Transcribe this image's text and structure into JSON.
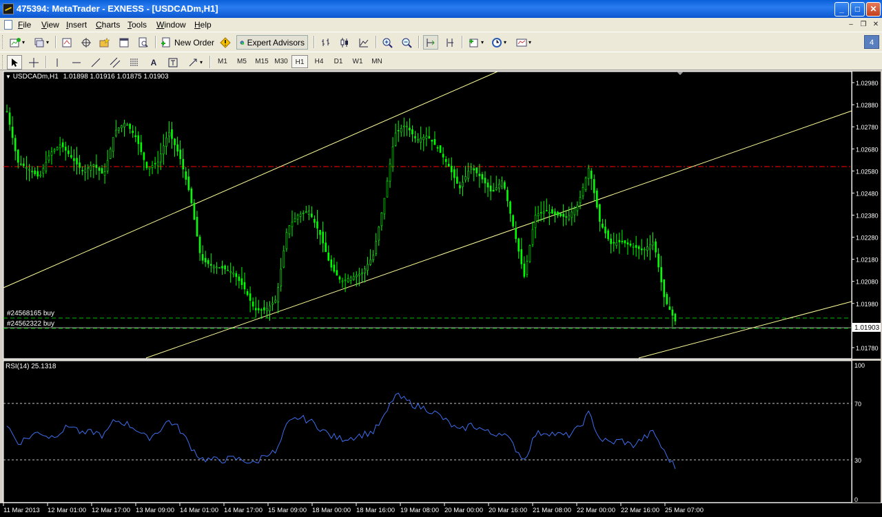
{
  "window": {
    "title": "475394: MetaTrader - EXNESS - [USDCADm,H1]",
    "buttons": {
      "minimize": "_",
      "maximize": "□",
      "close": "✕"
    }
  },
  "menu": {
    "items": [
      "File",
      "View",
      "Insert",
      "Charts",
      "Tools",
      "Window",
      "Help"
    ],
    "mdi": {
      "minimize": "–",
      "restore": "❐",
      "close": "✕"
    }
  },
  "toolbar": {
    "new_order": "New Order",
    "expert_advisors": "Expert Advisors",
    "badge": "4"
  },
  "timeframes": [
    "M1",
    "M5",
    "M15",
    "M30",
    "H1",
    "H4",
    "D1",
    "W1",
    "MN"
  ],
  "active_timeframe": "H1",
  "chart": {
    "symbol_label": "USDCADm,H1",
    "ohlc": "1.01898 1.01916 1.01875 1.01903",
    "current_price_label": "1.01903",
    "price_ticks": [
      "1.02980",
      "1.02880",
      "1.02780",
      "1.02680",
      "1.02580",
      "1.02480",
      "1.02380",
      "1.02280",
      "1.02180",
      "1.02080",
      "1.01980",
      "1.01880",
      "1.01780"
    ],
    "orders": [
      {
        "label": "#24568165 buy"
      },
      {
        "label": "#24562322 buy"
      }
    ],
    "colors": {
      "background": "#000000",
      "candles": "#00ff00",
      "trendlines": "#ffff99",
      "level_line": "#ff0000",
      "order_line": "#00c000",
      "rsi_line": "#3f6ff0"
    }
  },
  "rsi": {
    "label": "RSI(14) 25.1318",
    "ticks": [
      "100",
      "70",
      "30",
      "0"
    ]
  },
  "time_axis": [
    "11 Mar 2013",
    "12 Mar 01:00",
    "12 Mar 17:00",
    "13 Mar 09:00",
    "14 Mar 01:00",
    "14 Mar 17:00",
    "15 Mar 09:00",
    "18 Mar 00:00",
    "18 Mar 16:00",
    "19 Mar 08:00",
    "20 Mar 00:00",
    "20 Mar 16:00",
    "21 Mar 08:00",
    "22 Mar 00:00",
    "22 Mar 16:00",
    "25 Mar 07:00"
  ],
  "chart_data": {
    "type": "line",
    "title": "USDCADm,H1",
    "price_close_path": [
      1.0285,
      1.0262,
      1.0259,
      1.0255,
      1.0266,
      1.027,
      1.0264,
      1.0258,
      1.0261,
      1.0256,
      1.0276,
      1.028,
      1.0273,
      1.0259,
      1.0262,
      1.0276,
      1.0265,
      1.0247,
      1.0218,
      1.0215,
      1.0214,
      1.0212,
      1.0205,
      1.0195,
      1.0195,
      1.02,
      1.0232,
      1.0238,
      1.024,
      1.023,
      1.0215,
      1.0208,
      1.021,
      1.0212,
      1.022,
      1.0245,
      1.0275,
      1.0279,
      1.0272,
      1.0274,
      1.0268,
      1.026,
      1.025,
      1.026,
      1.0255,
      1.0248,
      1.0254,
      1.0232,
      1.021,
      1.0238,
      1.024,
      1.0238,
      1.0237,
      1.0243,
      1.026,
      1.0235,
      1.0225,
      1.0226,
      1.0224,
      1.0222,
      1.0226,
      1.02,
      1.019
    ],
    "rsi_path": [
      55,
      42,
      46,
      50,
      46,
      50,
      55,
      48,
      50,
      47,
      58,
      56,
      52,
      45,
      50,
      58,
      52,
      40,
      31,
      30,
      30,
      31,
      30,
      27,
      35,
      35,
      55,
      60,
      58,
      53,
      47,
      45,
      46,
      48,
      50,
      60,
      76,
      72,
      68,
      66,
      62,
      56,
      50,
      55,
      52,
      48,
      50,
      40,
      30,
      48,
      50,
      48,
      47,
      52,
      63,
      45,
      42,
      44,
      40,
      45,
      50,
      35,
      25
    ],
    "rsi_levels": [
      30,
      70
    ],
    "ylim": [
      1.0173,
      1.0303
    ],
    "rsi_ylim": [
      0,
      100
    ]
  }
}
